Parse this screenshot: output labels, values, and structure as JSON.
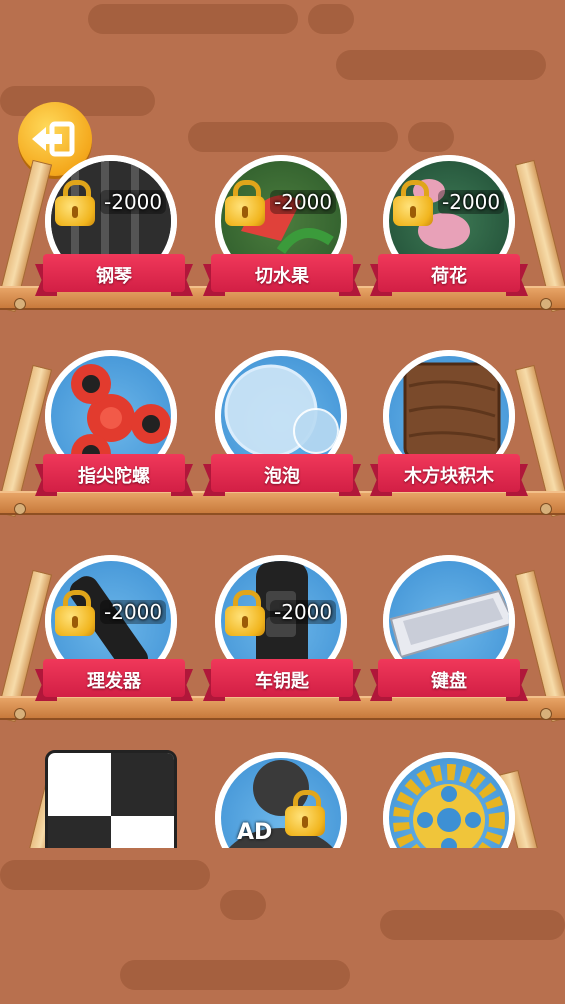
{
  "back_button": {
    "icon": "back-arrow-icon"
  },
  "shelves": [
    {
      "items": [
        {
          "name": "钢琴",
          "price": "-2000",
          "locked": true
        },
        {
          "name": "切水果",
          "price": "-2000",
          "locked": true
        },
        {
          "name": "荷花",
          "price": "-2000",
          "locked": true
        }
      ]
    },
    {
      "items": [
        {
          "name": "指尖陀螺",
          "locked": false
        },
        {
          "name": "泡泡",
          "locked": false
        },
        {
          "name": "木方块积木",
          "locked": false
        }
      ]
    },
    {
      "items": [
        {
          "name": "理发器",
          "price": "-2000",
          "locked": true
        },
        {
          "name": "车钥匙",
          "price": "-2000",
          "locked": true
        },
        {
          "name": "键盘",
          "locked": false
        }
      ]
    },
    {
      "items": [
        {
          "name": "",
          "locked": false
        },
        {
          "name": "",
          "ad": "AD",
          "locked": true
        },
        {
          "name": "",
          "locked": false
        }
      ]
    }
  ],
  "colors": {
    "background": "#b8704e",
    "ribbon": "#e02a4d",
    "disc": "#4a9ce0",
    "lock": "#f1b51e"
  }
}
